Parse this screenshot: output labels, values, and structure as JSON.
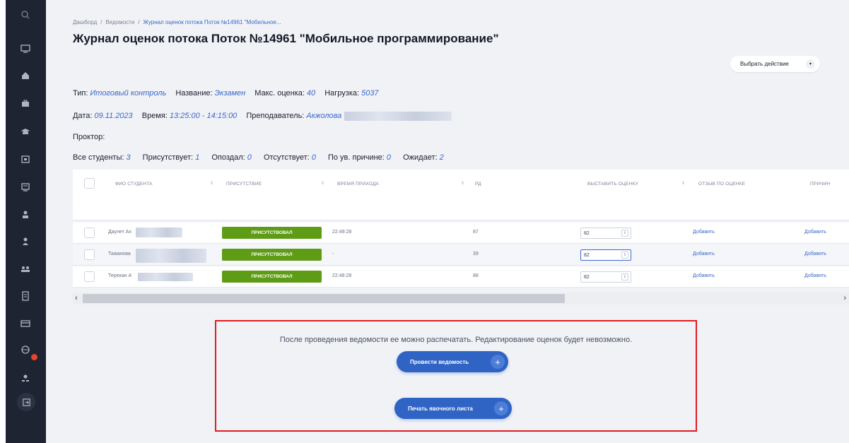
{
  "sidebar": {
    "icons": [
      "search-icon",
      "monitor-icon",
      "home-icon",
      "briefcase-icon",
      "graduation-cap-icon",
      "calendar-icon",
      "screen-icon",
      "users-icon",
      "user-icon",
      "group-icon",
      "document-icon",
      "card-icon",
      "globe-icon",
      "profile-icon",
      "logout-icon"
    ],
    "notification_color": "#e8442d"
  },
  "breadcrumb": {
    "items": [
      "Дашборд",
      "Ведомости",
      "Журнал оценок потока Поток №14961 \"Мобильное..."
    ]
  },
  "page_title": "Журнал оценок потока Поток №14961 \"Мобильное программирование\"",
  "action_button": "Выбрать действие",
  "info": {
    "type_label": "Тип:",
    "type_value": "Итоговый контроль",
    "name_label": "Название:",
    "name_value": "Экзамен",
    "max_label": "Макс. оценка:",
    "max_value": "40",
    "load_label": "Нагрузка:",
    "load_value": "5037",
    "date_label": "Дата:",
    "date_value": "09.11.2023",
    "time_label": "Время:",
    "time_value": "13:25:00 - 14:15:00",
    "teacher_label": "Преподаватель:",
    "teacher_value": "Акжолова",
    "proctor_label": "Проктор:"
  },
  "stats": {
    "all_label": "Все студенты:",
    "all_value": "3",
    "present_label": "Присутствует:",
    "present_value": "1",
    "late_label": "Опоздал:",
    "late_value": "0",
    "absent_label": "Отсутствует:",
    "absent_value": "0",
    "excused_label": "По ув. причине:",
    "excused_value": "0",
    "waiting_label": "Ожидает:",
    "waiting_value": "2"
  },
  "table": {
    "headers": [
      "ФИО СТУДЕНТА",
      "ПРИСУТСТВИЕ",
      "ВРЕМЯ ПРИХОДА",
      "РД",
      "ВЫСТАВИТЬ ОЦЕНКУ",
      "ОТЗЫВ ПО ОЦЕНКЕ",
      "ПРИЧИН"
    ],
    "rows": [
      {
        "name": "Даулет Ах",
        "status": "ПРИСУТСТВОВАЛ",
        "time": "22:49:28",
        "rd": "87",
        "grade": "82",
        "feedback": "Добавить",
        "reason": "Добавить"
      },
      {
        "name": "Тажанова",
        "status": "ПРИСУТСТВОВАЛ",
        "time": "-",
        "rd": "39",
        "grade": "82",
        "feedback": "Добавить",
        "reason": "Добавить"
      },
      {
        "name": "Терекан А",
        "status": "ПРИСУТСТВОВАЛ",
        "time": "22:48:28",
        "rd": "88",
        "grade": "82",
        "feedback": "Добавить",
        "reason": "Добавить"
      }
    ],
    "present_color": "#5e9c16"
  },
  "notice": {
    "text": "После проведения ведомости ее можно распечатать. Редактирование оценок будет невозможно.",
    "conduct_button": "Провести ведомость",
    "print_button": "Печать явочного листа",
    "border_color": "#e11b22"
  }
}
